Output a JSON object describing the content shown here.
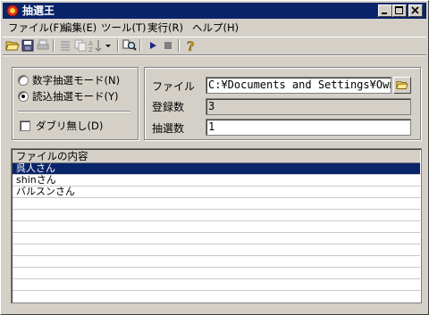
{
  "window": {
    "title": "抽選王"
  },
  "menu": [
    "ファイル(F)",
    "編集(E)",
    "ツール(T)",
    "実行(R)",
    "ヘルプ(H)"
  ],
  "options": {
    "random_mode": "数字抽選モード(N)",
    "read_mode": "読込抽選モード(Y)",
    "selected_mode": "read_mode",
    "no_duplicates": "ダブリ無し(D)",
    "no_duplicates_checked": false
  },
  "form": {
    "file_label": "ファイル",
    "file_value": "C:¥Documents and Settings¥Owner¥デ",
    "count_label": "登録数",
    "count_value": "3",
    "draw_label": "抽選数",
    "draw_value": "1"
  },
  "list": {
    "header": "ファイルの内容",
    "rows": [
      "呉人さん",
      "shinさん",
      "バルスンさん"
    ],
    "selected_index": 0
  }
}
